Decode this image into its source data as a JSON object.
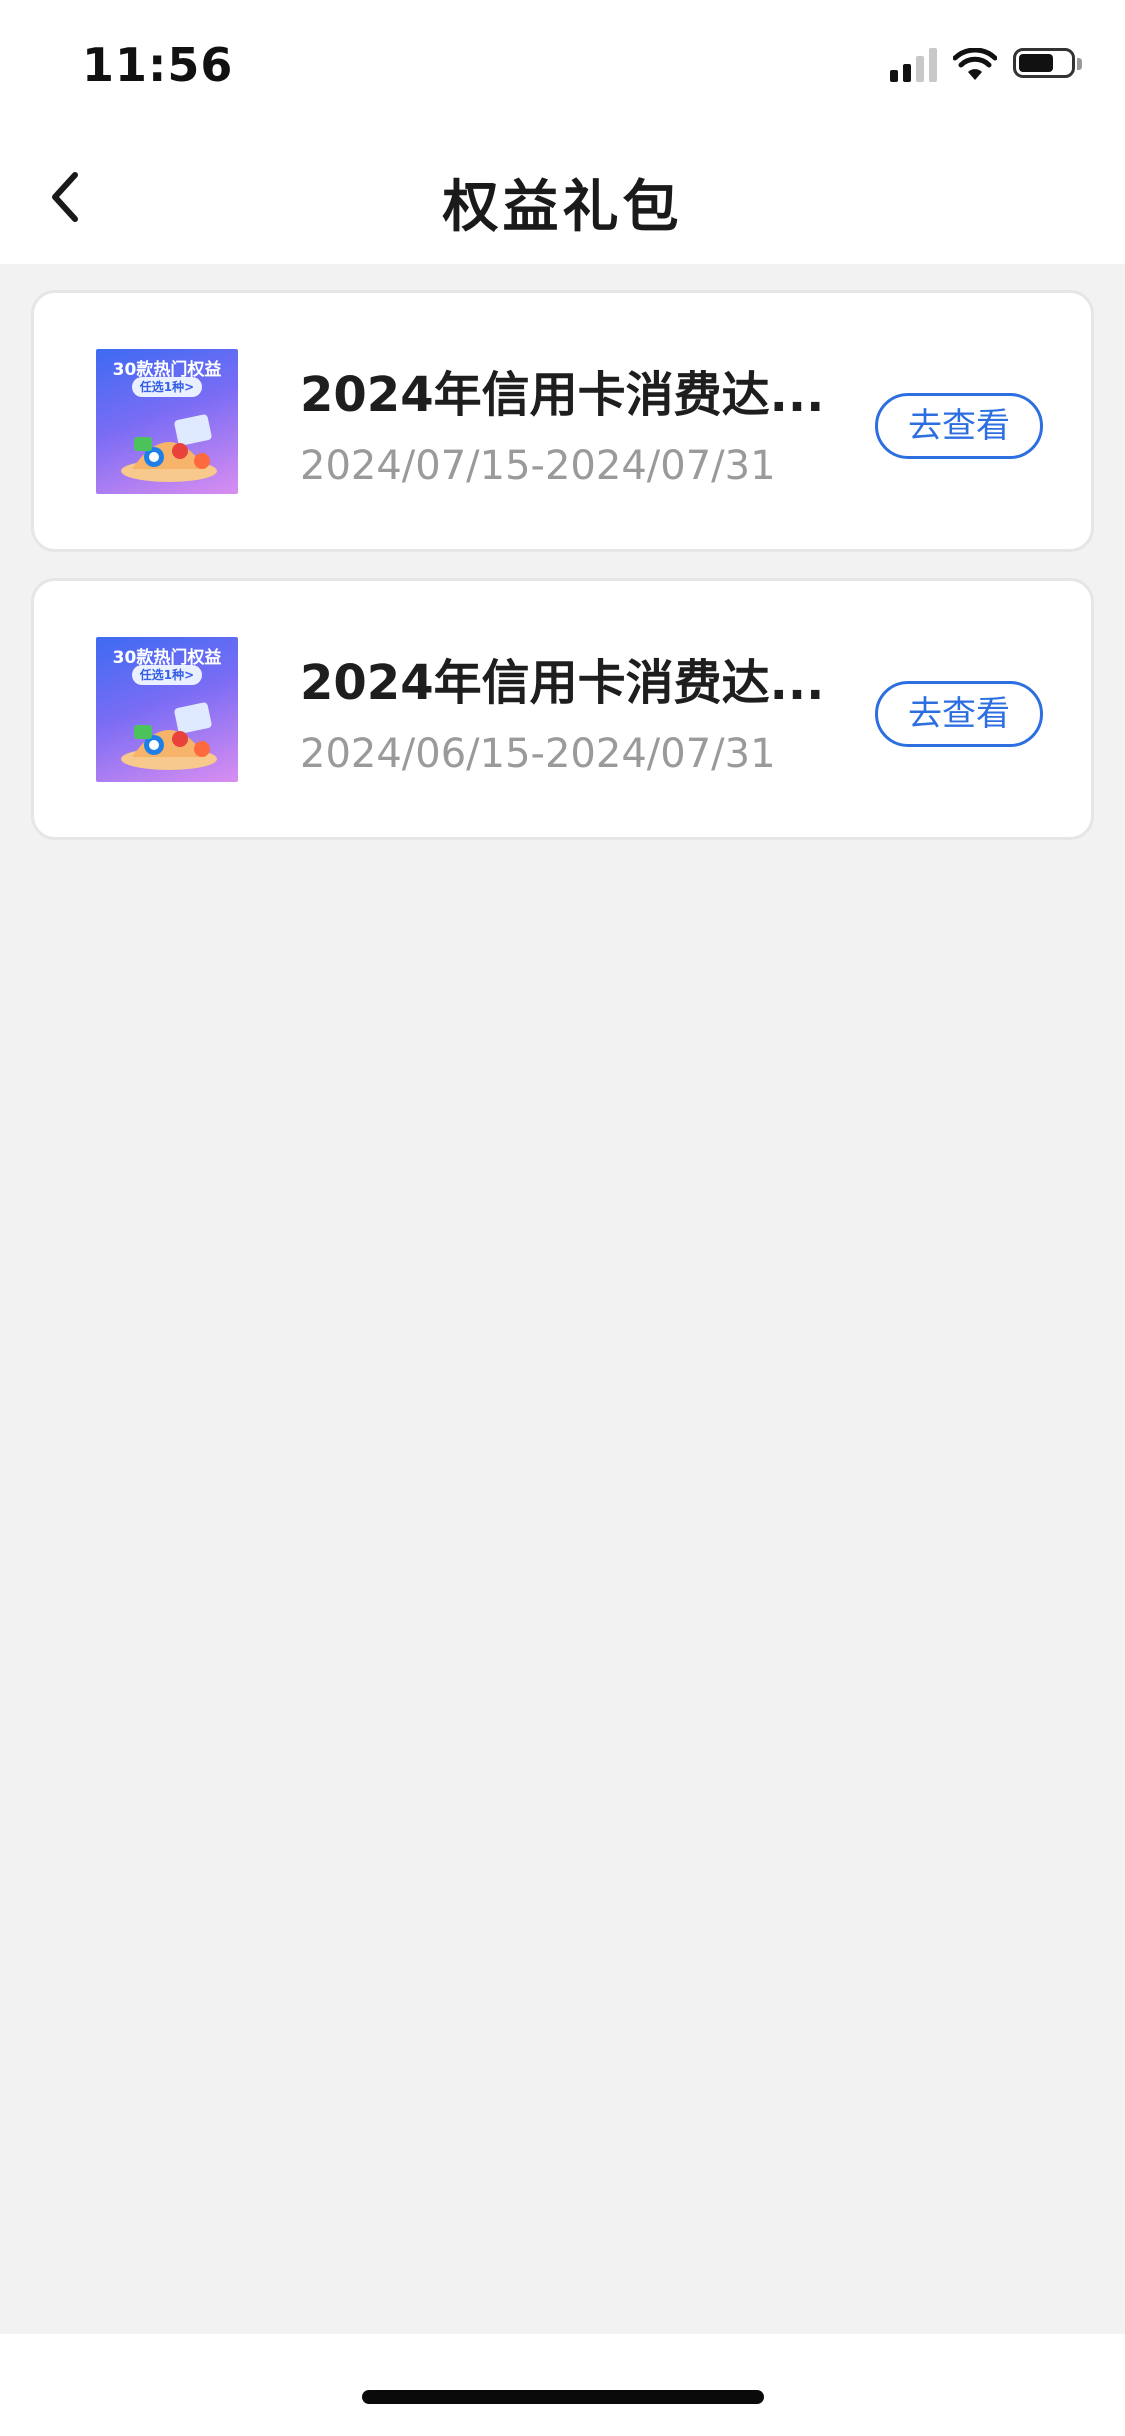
{
  "status_bar": {
    "time": "11:56"
  },
  "nav": {
    "title": "权益礼包",
    "back_icon": "chevron-left-icon"
  },
  "colors": {
    "accent": "#2d6fe0",
    "background": "#f2f2f2",
    "card": "#ffffff",
    "date_text": "#9a9a9a"
  },
  "packages": [
    {
      "thumb_headline": "30款热门权益",
      "thumb_pill": "任选1种>",
      "title": "2024年信用卡消费达...",
      "date_range": "2024/07/15-2024/07/31",
      "button_label": "去查看"
    },
    {
      "thumb_headline": "30款热门权益",
      "thumb_pill": "任选1种>",
      "title": "2024年信用卡消费达...",
      "date_range": "2024/06/15-2024/07/31",
      "button_label": "去查看"
    }
  ]
}
